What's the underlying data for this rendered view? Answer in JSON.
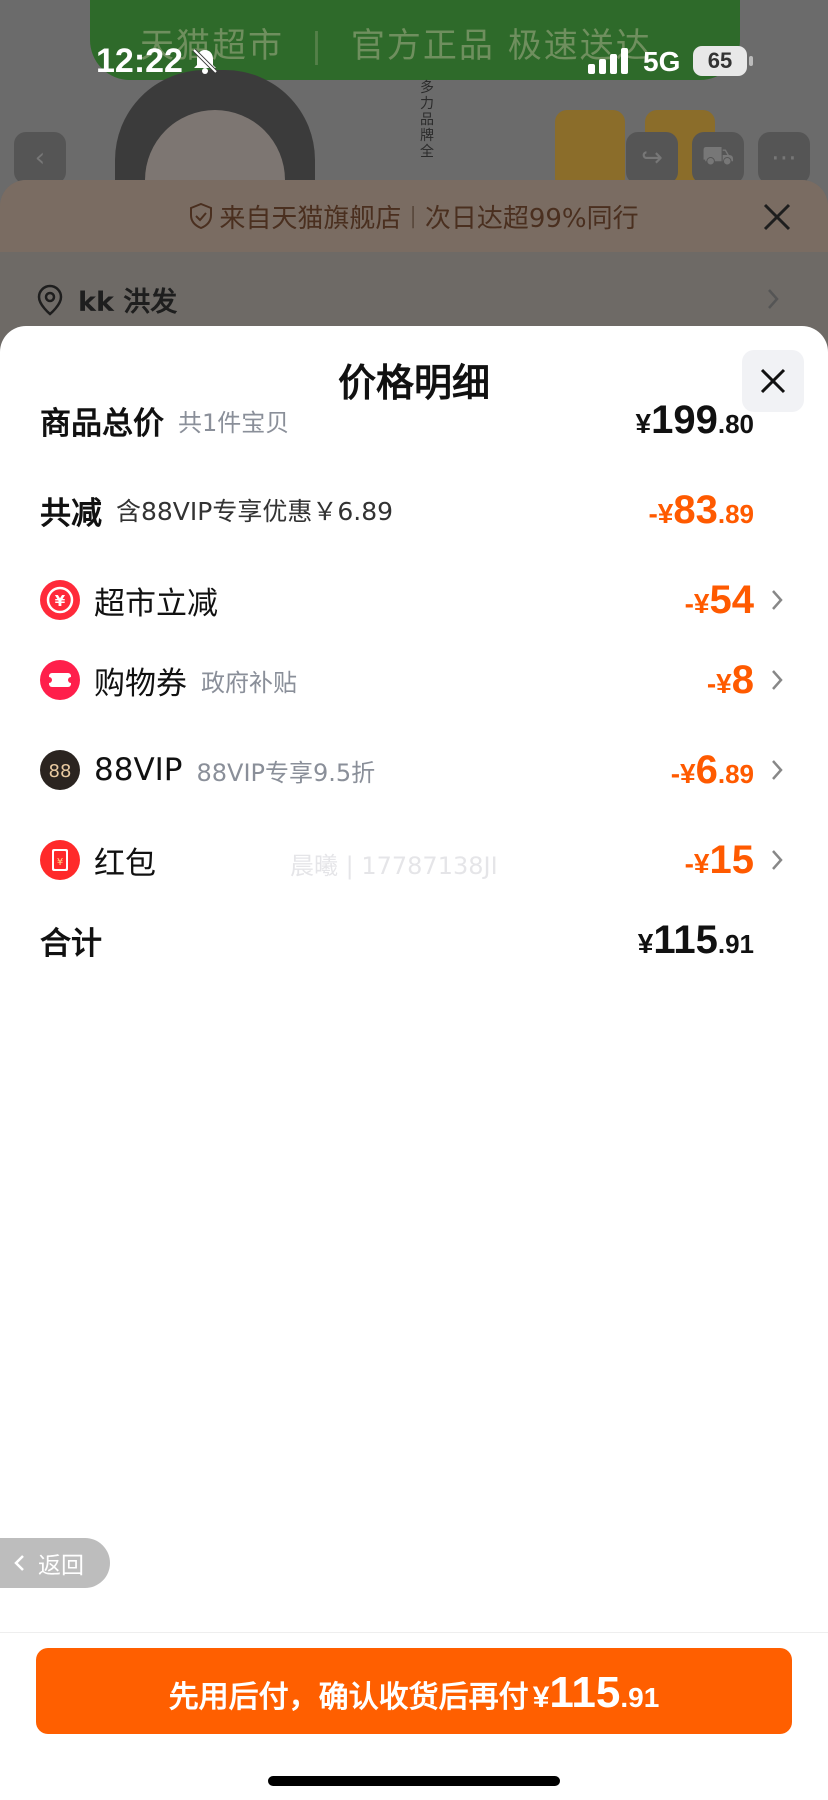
{
  "status_bar": {
    "time": "12:22",
    "network": "5G",
    "battery": "65"
  },
  "background": {
    "banner_title": "天猫超市",
    "banner_slogan": "官方正品 极速送达",
    "vertical_text": "多力品牌全"
  },
  "store_sheet": {
    "notice_left": "来自天猫旗舰店",
    "notice_right": "次日达超99%同行",
    "address": "kk 洪发"
  },
  "price_sheet": {
    "title": "价格明细",
    "total": {
      "label": "商品总价",
      "sub": "共1件宝贝",
      "currency": "¥",
      "int": "199",
      "dec": ".80"
    },
    "reduce": {
      "label": "共减",
      "sub": "含88VIP专享优惠￥6.89",
      "currency": "-¥",
      "int": "83",
      "dec": ".89"
    },
    "items": [
      {
        "label": "超市立减",
        "sub": "",
        "currency": "-¥",
        "int": "54",
        "dec": "",
        "icon": "supermarket-discount-icon"
      },
      {
        "label": "购物券",
        "sub": "政府补贴",
        "currency": "-¥",
        "int": "8",
        "dec": "",
        "icon": "coupon-icon"
      },
      {
        "label": "88VIP",
        "sub": "88VIP专享9.5折",
        "currency": "-¥",
        "int": "6",
        "dec": ".89",
        "icon": "vip88-icon"
      },
      {
        "label": "红包",
        "sub": "",
        "currency": "-¥",
        "int": "15",
        "dec": "",
        "icon": "red-packet-icon"
      }
    ],
    "sum": {
      "label": "合计",
      "currency": "¥",
      "int": "115",
      "dec": ".91"
    },
    "watermark": "晨曦 | 17787138JI"
  },
  "back_button": {
    "label": "返回"
  },
  "cta": {
    "text": "先用后付，确认收货后再付",
    "currency": "¥",
    "int": "115",
    "dec": ".91"
  },
  "colors": {
    "accent": "#ff5f00",
    "discount": "#ff5a00"
  }
}
